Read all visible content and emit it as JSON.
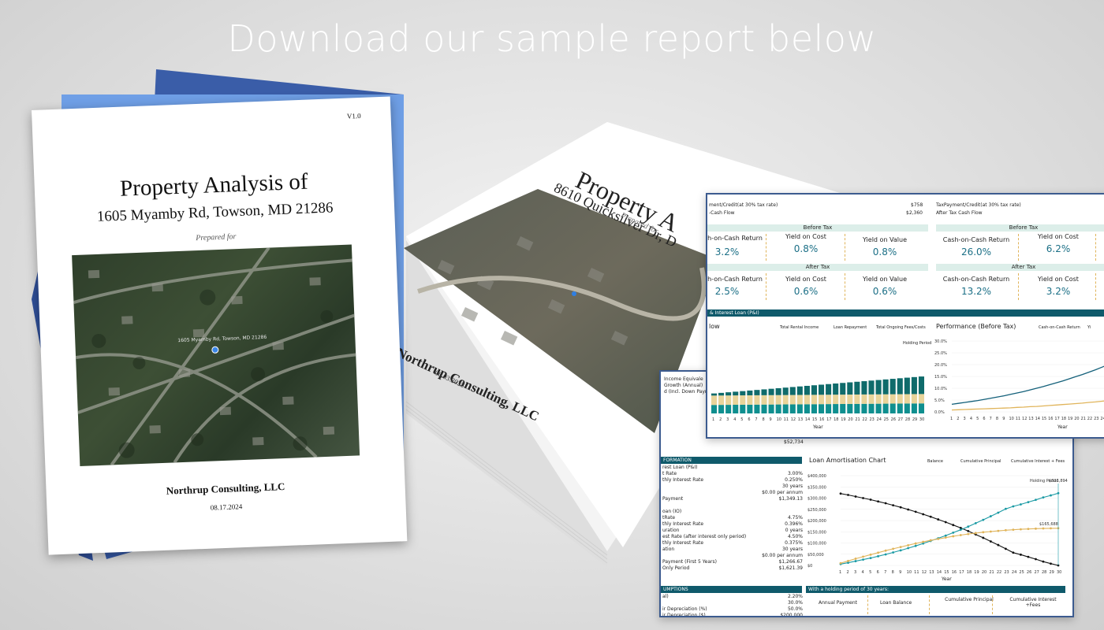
{
  "headline": "Download our sample report below",
  "cover": {
    "version": "V1.0",
    "title": "Property Analysis of",
    "address": "1605 Myamby Rd, Towson, MD 21286",
    "prepared_for": "Prepared for",
    "map_label": "1605 Myamby Rd, Towson, MD 21286",
    "firm": "Northrup Consulting, LLC",
    "date": "08.17.2024"
  },
  "stack": {
    "title": "Property A",
    "address": "8610 Quicksilver Dr, D",
    "prepared_for": "Prepared for",
    "firm": "Northrup Consulting, LLC",
    "date": "06.03.2025"
  },
  "sheet_b": {
    "row1_label": "ment/Credit(at 30% tax rate)",
    "row1_value": "$758",
    "row2_label": "-Cash Flow",
    "row2_value": "$2,360",
    "row1_label_r": "TaxPayment/Credit(at 30% tax rate)",
    "row2_label_r": "After Tax Cash Flow",
    "before_tax": "Before Tax",
    "after_tax": "After Tax",
    "left_before": [
      {
        "label": "h-on-Cash Return",
        "value": "3.2%"
      },
      {
        "label": "Yield on Cost",
        "value": "0.8%"
      },
      {
        "label": "Yield on Value",
        "value": "0.8%"
      }
    ],
    "left_after": [
      {
        "label": "h-on-Cash Return",
        "value": "2.5%"
      },
      {
        "label": "Yield on Cost",
        "value": "0.6%"
      },
      {
        "label": "Yield on Value",
        "value": "0.6%"
      }
    ],
    "right_before": [
      {
        "label": "Cash-on-Cash Return",
        "value": "26.0%"
      },
      {
        "label": "Yield on Cost",
        "value": "6.2%"
      }
    ],
    "right_after": [
      {
        "label": "Cash-on-Cash Return",
        "value": "13.2%"
      },
      {
        "label": "Yield on Cost",
        "value": "3.2%"
      }
    ],
    "loan_bar": "& Interest Loan (P&I)",
    "cf_title": "low",
    "cf_legend": [
      "Total Rental Income",
      "Loan Repayment",
      "Total Ongoing Fees/Costs"
    ],
    "holding_period": "Holding Period",
    "perf_title": "Performance (Before Tax)",
    "perf_legend": [
      "Cash-on-Cash Return",
      "Yi"
    ],
    "year_label": "Year",
    "perf_yticks": [
      "30.0%",
      "25.0%",
      "20.0%",
      "15.0%",
      "10.0%",
      "5.0%",
      "0.0%"
    ]
  },
  "sheet_a": {
    "top_left": [
      "Income  Equivale",
      "Growth  (Annual)",
      "d (Incl. Down Paym"
    ],
    "total": "$52,734",
    "info_header": "FORMATION",
    "info_rows": [
      {
        "label": "rest Loan (P&I)",
        "value": ""
      },
      {
        "label": "t Rate",
        "value": "3.00%"
      },
      {
        "label": "thly Interest Rate",
        "value": "0.250%"
      },
      {
        "label": "",
        "value": "30 years"
      },
      {
        "label": "",
        "value": "$0.00 per annum"
      },
      {
        "label": "Payment",
        "value": "$1,349.13"
      },
      {
        "label": "",
        "value": ""
      },
      {
        "label": "oan (IO)",
        "value": ""
      },
      {
        "label": "tRate",
        "value": "4.75%"
      },
      {
        "label": "thly Interest Rate",
        "value": "0.396%"
      },
      {
        "label": "uration",
        "value": "0 years"
      },
      {
        "label": "est Rate (after interest only period)",
        "value": "4.50%"
      },
      {
        "label": "thly Interest Rate",
        "value": "0.375%"
      },
      {
        "label": "ation",
        "value": "30 years"
      },
      {
        "label": "",
        "value": "$0.00 per annum"
      },
      {
        "label": "Payment (First 5 Years)",
        "value": "$1,266.67"
      },
      {
        "label": "Only Period",
        "value": "$1,621.39"
      }
    ],
    "assump_header": "UMPTIONS",
    "assump_rows": [
      {
        "label": "al)",
        "value": "2.20%"
      },
      {
        "label": "",
        "value": "30.0%"
      },
      {
        "label": "ir Depreciation (%)",
        "value": "50.0%"
      },
      {
        "label": "ir Depreciation ($)",
        "value": "$200,000"
      }
    ],
    "amort_title": "Loan Amortisation Chart",
    "amort_legend": [
      "Balance",
      "Cumulative Principal",
      "Cumulative Interest + Fees"
    ],
    "amort_yticks": [
      "$400,000",
      "$350,000",
      "$300,000",
      "$250,000",
      "$200,000",
      "$150,000",
      "$100,000",
      "$50,000",
      "$0"
    ],
    "holding_note": "Holding Period",
    "value_321": "$321,894",
    "value_165": "$165,688",
    "year_label": "Year",
    "holding_bar": "With a holding period of 30 years:",
    "bottom_cols": [
      "Annual Payment",
      "Loan Balance",
      "Cumulative Principal",
      "Cumulative Interest +Fees"
    ]
  },
  "chart_data": [
    {
      "type": "bar",
      "title": "",
      "categories": [
        "1",
        "2",
        "3",
        "4",
        "5",
        "6",
        "7",
        "8",
        "9",
        "10",
        "11",
        "12",
        "13",
        "14",
        "15",
        "16",
        "17",
        "18",
        "19",
        "20",
        "21",
        "22",
        "23",
        "24",
        "25",
        "26",
        "27",
        "28",
        "29",
        "30"
      ],
      "series": [
        {
          "name": "Total Rental Income",
          "values": [
            16,
            16.5,
            17,
            17.5,
            18,
            18.5,
            19,
            19.5,
            20,
            20.5,
            21,
            21.5,
            22,
            22.5,
            23,
            23.5,
            24,
            24.5,
            25,
            25.5,
            26,
            26.5,
            27,
            27.5,
            28,
            28.5,
            29,
            29.5,
            30,
            30.5
          ]
        },
        {
          "name": "Loan Repayment",
          "values": [
            16,
            16,
            16,
            16,
            16,
            16,
            16,
            16,
            16,
            16,
            16,
            16,
            16,
            16,
            16,
            16,
            16,
            16,
            16,
            16,
            16,
            16,
            16,
            16,
            16,
            16,
            16,
            16,
            16,
            16
          ]
        },
        {
          "name": "Total Ongoing Fees/Costs",
          "values": [
            4,
            4.1,
            4.2,
            4.3,
            4.4,
            4.5,
            4.6,
            4.7,
            4.8,
            4.9,
            5,
            5.1,
            5.2,
            5.3,
            5.4,
            5.5,
            5.6,
            5.7,
            5.8,
            5.9,
            6,
            6.1,
            6.2,
            6.3,
            6.4,
            6.5,
            6.6,
            6.7,
            6.8,
            6.9
          ]
        }
      ],
      "xlabel": "Year",
      "ylabel": ""
    },
    {
      "type": "line",
      "title": "Performance (Before Tax)",
      "x": [
        1,
        2,
        3,
        4,
        5,
        6,
        7,
        8,
        9,
        10,
        11,
        12,
        13,
        14,
        15,
        16,
        17,
        18,
        19,
        20,
        21,
        22,
        23,
        24,
        25,
        26,
        27,
        28,
        29,
        30
      ],
      "series": [
        {
          "name": "Cash-on-Cash Return",
          "values": [
            3.2,
            3.6,
            4,
            4.4,
            4.8,
            5.3,
            5.8,
            6.3,
            6.8,
            7.4,
            8,
            8.6,
            9.3,
            10,
            10.7,
            11.5,
            12.3,
            13.1,
            14,
            14.9,
            15.8,
            16.8,
            17.8,
            18.9,
            20,
            21.1,
            22.3,
            23.5,
            24.8,
            26
          ]
        },
        {
          "name": "Yi",
          "values": [
            0.8,
            0.9,
            1,
            1.1,
            1.2,
            1.3,
            1.4,
            1.5,
            1.6,
            1.7,
            1.9,
            2,
            2.2,
            2.3,
            2.5,
            2.7,
            2.9,
            3.1,
            3.3,
            3.5,
            3.7,
            4,
            4.2,
            4.5,
            4.8,
            5,
            5.3,
            5.6,
            5.9,
            6.2
          ]
        }
      ],
      "xlabel": "Year",
      "ylim": [
        0,
        30
      ]
    },
    {
      "type": "line",
      "title": "Loan Amortisation Chart",
      "x": [
        1,
        2,
        3,
        4,
        5,
        6,
        7,
        8,
        9,
        10,
        11,
        12,
        13,
        14,
        15,
        16,
        17,
        18,
        19,
        20,
        21,
        22,
        23,
        24,
        25,
        26,
        27,
        28,
        29,
        30
      ],
      "series": [
        {
          "name": "Balance",
          "values": [
            320000,
            314000,
            307000,
            300000,
            293000,
            285000,
            277000,
            268000,
            259000,
            249000,
            239000,
            228000,
            217000,
            205000,
            193000,
            180000,
            167000,
            153000,
            138000,
            123000,
            107000,
            91000,
            74000,
            57000,
            48000,
            38000,
            28000,
            17000,
            8000,
            0
          ]
        },
        {
          "name": "Cumulative Principal",
          "values": [
            6000,
            12000,
            19000,
            26000,
            33000,
            41000,
            49000,
            58000,
            67000,
            77000,
            87000,
            98000,
            109000,
            121000,
            133000,
            146000,
            159000,
            173000,
            188000,
            203000,
            219000,
            235000,
            252000,
            263000,
            272000,
            282000,
            292000,
            303000,
            312000,
            321894
          ]
        },
        {
          "name": "Cumulative Interest + Fees",
          "values": [
            10000,
            20000,
            30000,
            39000,
            48000,
            57000,
            66000,
            74000,
            82000,
            90000,
            98000,
            105000,
            112000,
            118000,
            124000,
            130000,
            135000,
            140000,
            144000,
            148000,
            151000,
            154000,
            157000,
            159000,
            161000,
            162500,
            163800,
            164700,
            165300,
            165688
          ]
        }
      ],
      "xlabel": "Year",
      "ylim": [
        0,
        400000
      ]
    }
  ]
}
